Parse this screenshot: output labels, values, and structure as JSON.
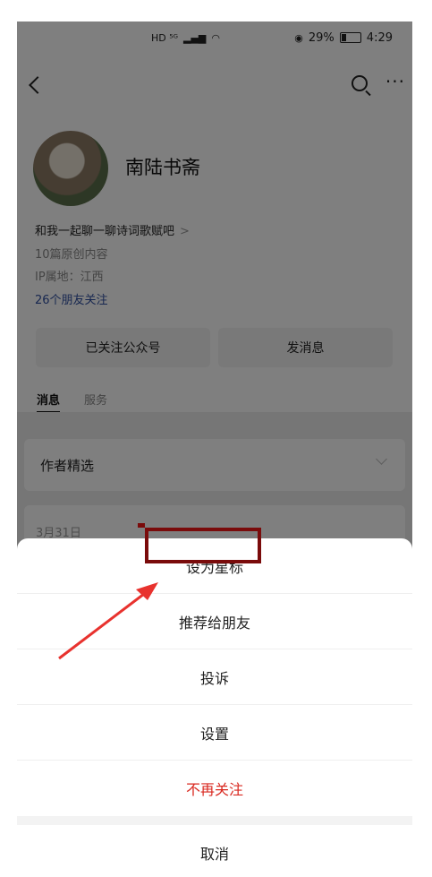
{
  "status_bar": {
    "network_icons": "HD ⁵ᴳ",
    "eye_battery": "29%",
    "time": "4:29"
  },
  "account": {
    "name": "南陆书斋",
    "description": "和我一起聊一聊诗词歌赋吧",
    "articles": "10篇原创内容",
    "ip_location": "IP属地：江西",
    "friends_following": "26个朋友关注",
    "followed_button": "已关注公众号",
    "message_button": "发消息"
  },
  "tabs": {
    "messages": "消息",
    "service": "服务"
  },
  "feed": {
    "featured_title": "作者精选",
    "date": "3月31日"
  },
  "sheet": {
    "star": "设为星标",
    "recommend": "推荐给朋友",
    "report": "投诉",
    "settings": "设置",
    "unfollow": "不再关注",
    "cancel": "取消"
  },
  "colors": {
    "unfollow_red": "#d9281f",
    "friend_link": "#2f4fa0",
    "annotation": "#7a0b0b",
    "arrow": "#e8322e"
  }
}
